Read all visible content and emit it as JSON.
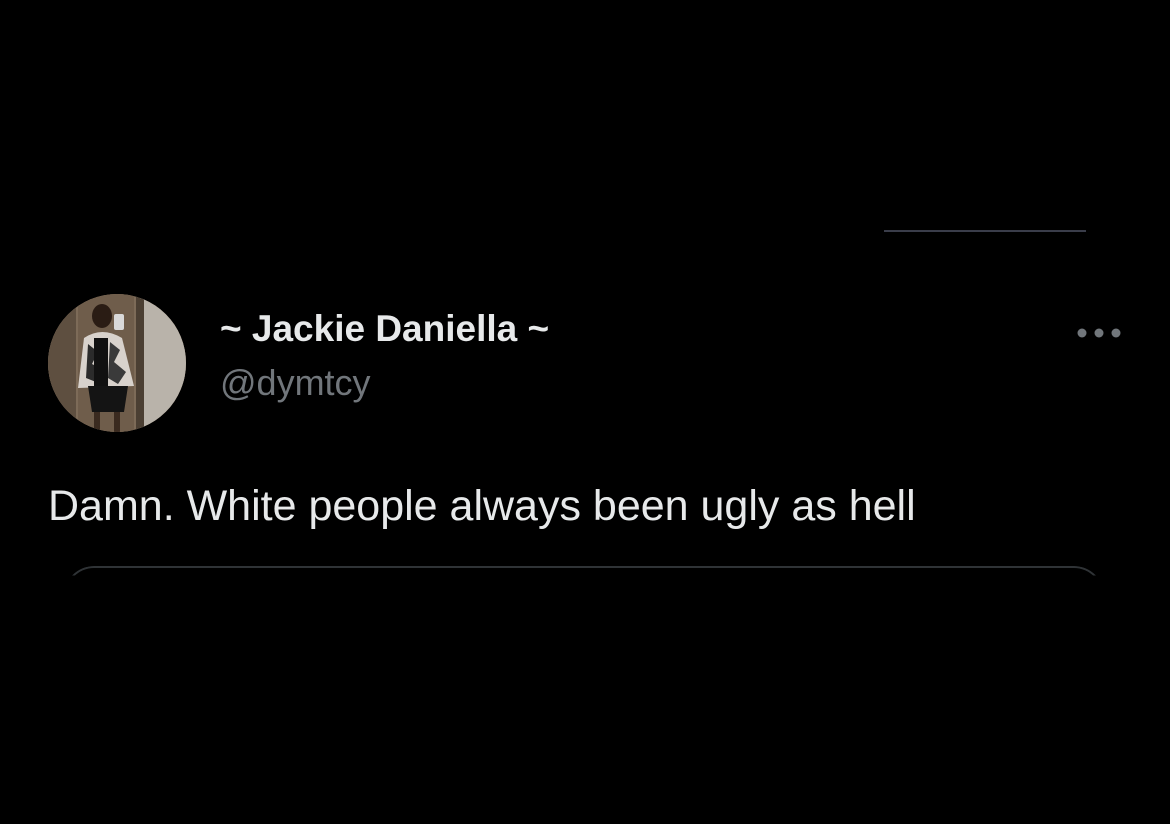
{
  "tweet": {
    "author": {
      "display_name": "~ Jackie Daniella ~",
      "handle": "@dymtcy"
    },
    "text": "Damn. White people always been ugly as hell",
    "more_icon": "more-horizontal-icon"
  },
  "colors": {
    "background": "#000000",
    "primary_text": "#e7e9ea",
    "secondary_text": "#71767b",
    "border": "#2f3336"
  }
}
